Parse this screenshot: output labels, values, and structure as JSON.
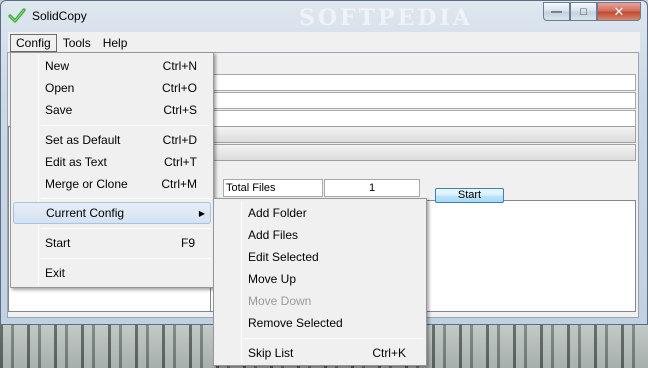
{
  "window": {
    "title": "SolidCopy",
    "watermark": "SOFTPEDIA",
    "minimize_glyph": "—",
    "maximize_glyph": "□",
    "close_glyph": "✕"
  },
  "menubar": {
    "items": [
      "Config",
      "Tools",
      "Help"
    ],
    "active": "Config"
  },
  "config_menu": {
    "items": [
      {
        "label": "New",
        "shortcut": "Ctrl+N"
      },
      {
        "label": "Open",
        "shortcut": "Ctrl+O"
      },
      {
        "label": "Save",
        "shortcut": "Ctrl+S"
      },
      {
        "label": "Set as Default",
        "shortcut": "Ctrl+D"
      },
      {
        "label": "Edit as Text",
        "shortcut": "Ctrl+T"
      },
      {
        "label": "Merge or Clone",
        "shortcut": "Ctrl+M"
      },
      {
        "label": "Current Config",
        "shortcut": "",
        "submenu": true
      },
      {
        "label": "Start",
        "shortcut": "F9"
      },
      {
        "label": "Exit",
        "shortcut": ""
      }
    ],
    "highlighted": "Current Config"
  },
  "current_config_submenu": {
    "items": [
      {
        "label": "Add Folder",
        "shortcut": "",
        "enabled": true
      },
      {
        "label": "Add Files",
        "shortcut": "",
        "enabled": true
      },
      {
        "label": "Edit Selected",
        "shortcut": "",
        "enabled": true
      },
      {
        "label": "Move Up",
        "shortcut": "",
        "enabled": true
      },
      {
        "label": "Move Down",
        "shortcut": "",
        "enabled": false
      },
      {
        "label": "Remove Selected",
        "shortcut": "",
        "enabled": true
      },
      {
        "label": "Skip List",
        "shortcut": "Ctrl+K",
        "enabled": true
      }
    ]
  },
  "main": {
    "total_files_label": "Total Files",
    "total_files_value": "1",
    "start_button": "Start"
  }
}
